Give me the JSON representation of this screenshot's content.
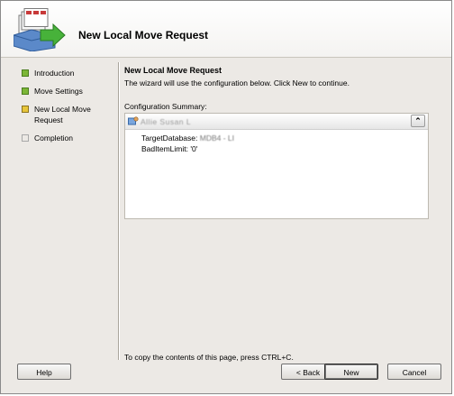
{
  "window": {
    "title": "New Local Move Request"
  },
  "nav": {
    "items": [
      {
        "label": "Introduction",
        "state": "done"
      },
      {
        "label": "Move Settings",
        "state": "done"
      },
      {
        "label": "New Local Move Request",
        "state": "current"
      },
      {
        "label": "Completion",
        "state": "pending"
      }
    ]
  },
  "content": {
    "title": "New Local Move Request",
    "description": "The wizard will use the configuration below.  Click New to continue.",
    "summary_label": "Configuration Summary:",
    "summary_item_name": "Allie Susan L",
    "details": [
      {
        "key": "TargetDatabase:",
        "value": "MDB4 - LI"
      },
      {
        "key": "BadItemLimit:",
        "value": "'0'"
      }
    ],
    "copy_hint": "To copy the contents of this page, press CTRL+C."
  },
  "buttons": {
    "help": "Help",
    "back": "Back",
    "new": "New",
    "cancel": "Cancel"
  },
  "colors": {
    "done": "#7cb637",
    "current": "#e7c53a",
    "background": "#ece9e5"
  }
}
